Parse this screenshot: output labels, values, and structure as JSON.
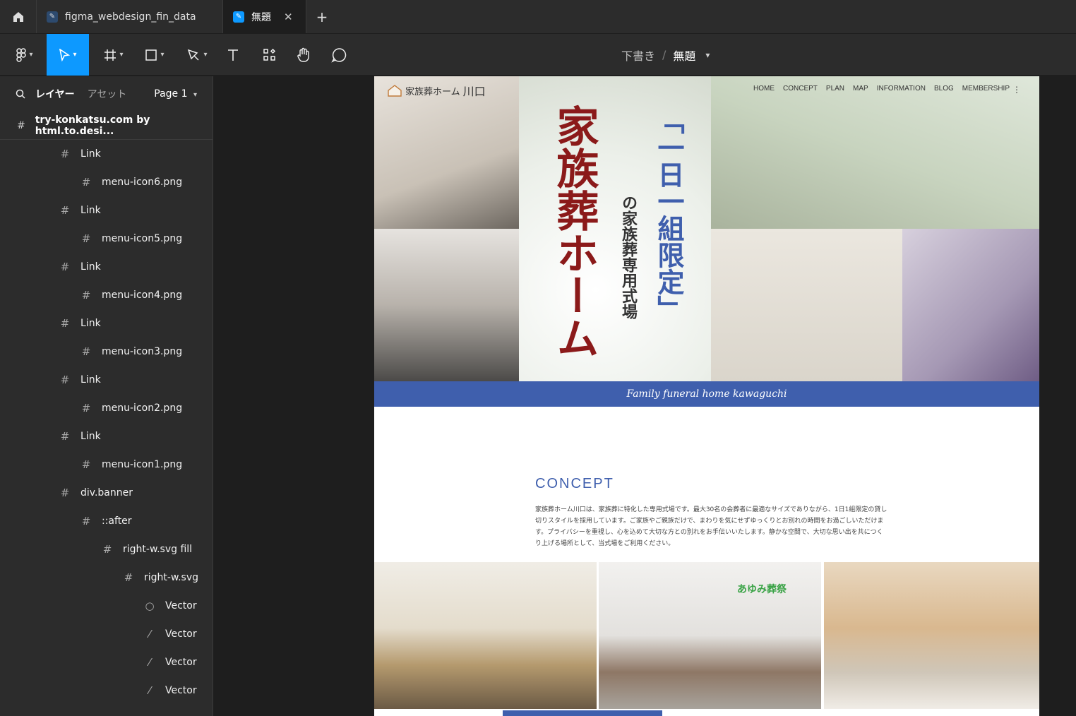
{
  "tabs": [
    {
      "label": "figma_webdesign_fin_data",
      "active": false
    },
    {
      "label": "無題",
      "active": true
    }
  ],
  "toolbar": {
    "breadcrumb_parent": "下書き",
    "breadcrumb_sep": "/",
    "breadcrumb_current": "無題"
  },
  "left_panel": {
    "tab_layers": "レイヤー",
    "tab_assets": "アセット",
    "page_selector": "Page 1",
    "root_frame": "try-konkatsu.com by html.to.desi...",
    "layers": [
      {
        "label": "Link",
        "indent": 1,
        "icon": "frame-icon"
      },
      {
        "label": "menu-icon6.png",
        "indent": 2,
        "icon": "frame-icon"
      },
      {
        "label": "Link",
        "indent": 1,
        "icon": "frame-icon"
      },
      {
        "label": "menu-icon5.png",
        "indent": 2,
        "icon": "frame-icon"
      },
      {
        "label": "Link",
        "indent": 1,
        "icon": "frame-icon"
      },
      {
        "label": "menu-icon4.png",
        "indent": 2,
        "icon": "frame-icon"
      },
      {
        "label": "Link",
        "indent": 1,
        "icon": "frame-icon"
      },
      {
        "label": "menu-icon3.png",
        "indent": 2,
        "icon": "frame-icon"
      },
      {
        "label": "Link",
        "indent": 1,
        "icon": "frame-icon"
      },
      {
        "label": "menu-icon2.png",
        "indent": 2,
        "icon": "frame-icon"
      },
      {
        "label": "Link",
        "indent": 1,
        "icon": "frame-icon"
      },
      {
        "label": "menu-icon1.png",
        "indent": 2,
        "icon": "frame-icon"
      },
      {
        "label": "div.banner",
        "indent": 1,
        "icon": "frame-icon"
      },
      {
        "label": "::after",
        "indent": 2,
        "icon": "frame-icon"
      },
      {
        "label": "right-w.svg fill",
        "indent": 3,
        "icon": "frame-icon"
      },
      {
        "label": "right-w.svg",
        "indent": 4,
        "icon": "frame-icon"
      },
      {
        "label": "Vector",
        "indent": 5,
        "icon": "ellipse-icon"
      },
      {
        "label": "Vector",
        "indent": 5,
        "icon": "line-icon"
      },
      {
        "label": "Vector",
        "indent": 5,
        "icon": "line-icon"
      },
      {
        "label": "Vector",
        "indent": 5,
        "icon": "line-icon"
      }
    ]
  },
  "site": {
    "logo_text": "家族葬ホーム",
    "logo_accent": "川口",
    "nav": [
      "HOME",
      "CONCEPT",
      "PLAN",
      "MAP",
      "INFORMATION",
      "BLOG",
      "MEMBERSHIP"
    ],
    "hero_title": "家族葬ホーム",
    "hero_tag": "「一日一組限定」",
    "hero_sub": "の家族葬専用式場",
    "banner_text": "Family funeral home kawaguchi",
    "concept_title": "CONCEPT",
    "concept_body": "家族葬ホーム川口は、家族葬に特化した専用式場です。最大30名の会葬者に最適なサイズでありながら、1日1組限定の貸し切りスタイルを採用しています。ご家族やご親族だけで、まわりを気にせずゆっくりとお別れの時間をお過ごしいただけます。プライバシーを重視し、心を込めて大切な方との別れをお手伝いいたします。静かな空間で、大切な思い出を共につくり上げる場所として、当式場をご利用ください。",
    "sign_text": "あゆみ葬祭"
  },
  "colors": {
    "accent": "#0d99ff",
    "site_blue": "#3f5fad",
    "hero_red": "#8b1a1a"
  }
}
